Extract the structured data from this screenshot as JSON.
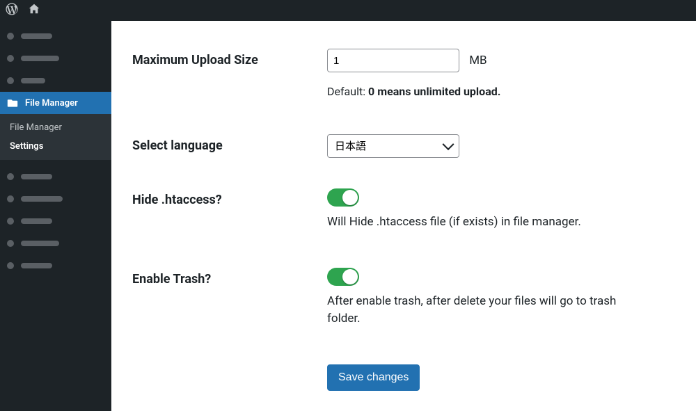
{
  "adminbar": {},
  "sidebar": {
    "active_label": "File Manager",
    "submenu": {
      "item0": "File Manager",
      "item1": "Settings"
    }
  },
  "form": {
    "upload_size": {
      "label": "Maximum Upload Size",
      "value": "1",
      "unit": "MB",
      "help_prefix": "Default: ",
      "help_bold": "0 means unlimited upload."
    },
    "language": {
      "label": "Select language",
      "value": "日本語"
    },
    "hide_htaccess": {
      "label": "Hide .htaccess?",
      "enabled": true,
      "desc": "Will Hide .htaccess file (if exists) in file manager."
    },
    "enable_trash": {
      "label": "Enable Trash?",
      "enabled": true,
      "desc": "After enable trash, after delete your files will go to trash folder."
    },
    "save_label": "Save changes"
  }
}
